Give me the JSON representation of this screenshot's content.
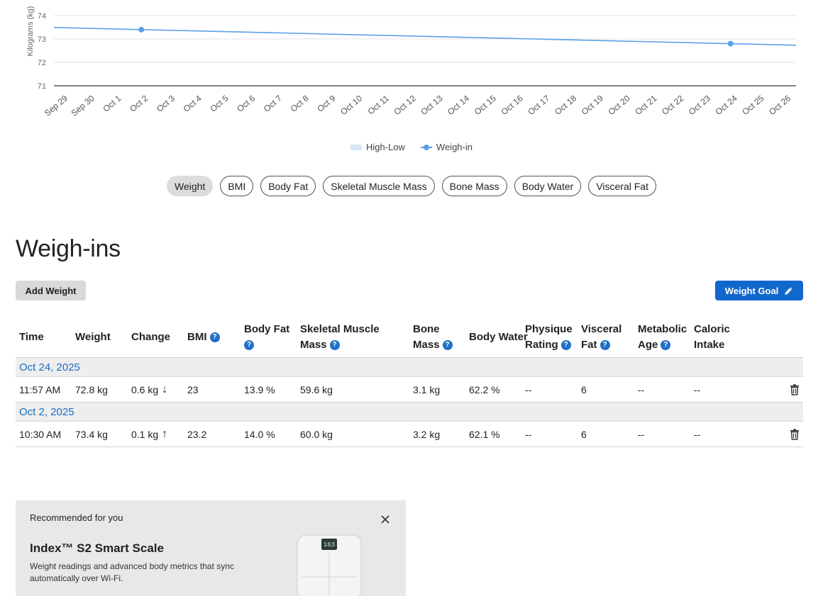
{
  "chart_data": {
    "type": "line",
    "ylabel": "Kilograms (kg)",
    "ylim": [
      71,
      75
    ],
    "yticks": [
      71,
      72,
      73,
      74
    ],
    "categories": [
      "Sep 29",
      "Sep 30",
      "Oct 1",
      "Oct 2",
      "Oct 3",
      "Oct 4",
      "Oct 5",
      "Oct 6",
      "Oct 7",
      "Oct 8",
      "Oct 9",
      "Oct 10",
      "Oct 11",
      "Oct 12",
      "Oct 13",
      "Oct 14",
      "Oct 15",
      "Oct 16",
      "Oct 17",
      "Oct 18",
      "Oct 19",
      "Oct 20",
      "Oct 21",
      "Oct 22",
      "Oct 23",
      "Oct 24",
      "Oct 25",
      "Oct 26"
    ],
    "series": [
      {
        "name": "Weigh-in",
        "color": "#5aa0e6",
        "points": [
          {
            "x": "Oct 2",
            "y": 73.4
          },
          {
            "x": "Oct 24",
            "y": 72.8
          }
        ]
      }
    ],
    "legend": [
      "High-Low",
      "Weigh-in"
    ],
    "legend_position": "bottom",
    "grid": true
  },
  "metric_tabs": [
    "Weight",
    "BMI",
    "Body Fat",
    "Skeletal Muscle Mass",
    "Bone Mass",
    "Body Water",
    "Visceral Fat"
  ],
  "active_tab": "Weight",
  "section_title": "Weigh-ins",
  "buttons": {
    "add_weight": "Add Weight",
    "weight_goal": "Weight Goal"
  },
  "table": {
    "columns": [
      {
        "l1": "Time",
        "l2": "",
        "help": false
      },
      {
        "l1": "Weight",
        "l2": "",
        "help": false
      },
      {
        "l1": "Change",
        "l2": "",
        "help": false
      },
      {
        "l1": "BMI",
        "l2": "",
        "help": true
      },
      {
        "l1": "Body Fat",
        "l2": "",
        "help": true
      },
      {
        "l1": "Skeletal Muscle",
        "l2": "Mass",
        "help": true
      },
      {
        "l1": "Bone",
        "l2": "Mass",
        "help": true
      },
      {
        "l1": "Body Water",
        "l2": "",
        "help": false
      },
      {
        "l1": "Physique",
        "l2": "Rating",
        "help": true
      },
      {
        "l1": "Visceral",
        "l2": "Fat",
        "help": true
      },
      {
        "l1": "Metabolic",
        "l2": "Age",
        "help": true
      },
      {
        "l1": "Caloric",
        "l2": "Intake",
        "help": false
      }
    ],
    "groups": [
      {
        "date": "Oct 24, 2025",
        "rows": [
          {
            "time": "11:57 AM",
            "weight": "72.8 kg",
            "change": "0.6 kg",
            "change_dir": "↓",
            "bmi": "23",
            "body_fat": "13.9 %",
            "skeletal_muscle_mass": "59.6 kg",
            "bone_mass": "3.1 kg",
            "body_water": "62.2 %",
            "physique_rating": "--",
            "visceral_fat": "6",
            "metabolic_age": "--",
            "caloric_intake": "--"
          }
        ]
      },
      {
        "date": "Oct 2, 2025",
        "rows": [
          {
            "time": "10:30 AM",
            "weight": "73.4 kg",
            "change": "0.1 kg",
            "change_dir": "↑",
            "bmi": "23.2",
            "body_fat": "14.0 %",
            "skeletal_muscle_mass": "60.0 kg",
            "bone_mass": "3.2 kg",
            "body_water": "62.1 %",
            "physique_rating": "--",
            "visceral_fat": "6",
            "metabolic_age": "--",
            "caloric_intake": "--"
          }
        ]
      }
    ]
  },
  "promo": {
    "kicker": "Recommended for you",
    "title": "Index™ S2 Smart Scale",
    "description": "Weight readings and advanced body metrics that sync automatically over Wi-Fi.",
    "scale_display": "163"
  },
  "icons": {
    "help": "help-icon",
    "pencil": "pencil-icon",
    "trash": "trash-icon",
    "close": "close-icon"
  },
  "colors": {
    "accent": "#1267cc",
    "series": "#5aa0e6",
    "band": "#d6e6f6",
    "link": "#1a6cc4"
  }
}
